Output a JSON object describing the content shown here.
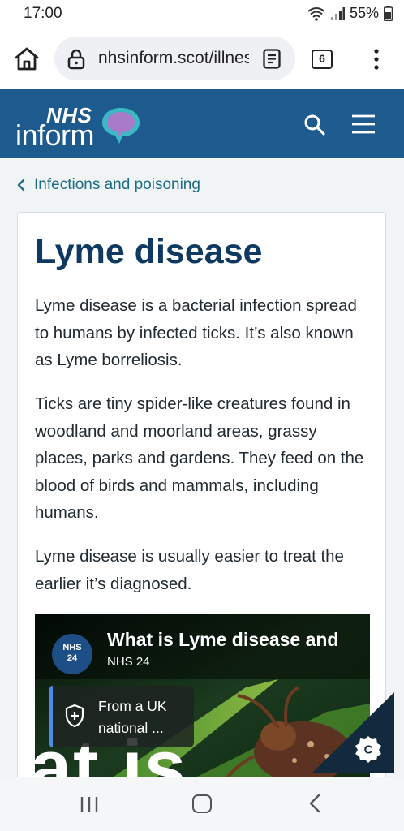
{
  "status_bar": {
    "time": "17:00",
    "battery": "55%",
    "icons": [
      "wifi-icon",
      "signal-icon",
      "battery-icon"
    ]
  },
  "browser": {
    "url": "nhsinform.scot/illness-and-conditions",
    "tab_count": "6"
  },
  "header": {
    "logo_nhs": "NHS",
    "logo_inform": "inform",
    "brand_color": "#1d5a8e"
  },
  "breadcrumb": {
    "label": "Infections and poisoning"
  },
  "article": {
    "title": "Lyme disease",
    "paragraphs": [
      "Lyme disease is a bacterial infection spread to humans by infected ticks. It’s also known as Lyme borreliosis.",
      "Ticks are tiny spider-like creatures found in woodland and moorland areas, grassy places, parks and gardens. They feed on the blood of birds and mammals, including humans.",
      "Lyme disease is usually easier to treat the earlier it’s diagnosed."
    ]
  },
  "video": {
    "title": "What is Lyme disease and",
    "channel": "NHS 24",
    "channel_logo_top": "NHS",
    "channel_logo_bottom": "24",
    "notice": "From a UK national ...",
    "overlay_text": "at is"
  },
  "cookie_badge": {
    "letter": "C"
  }
}
